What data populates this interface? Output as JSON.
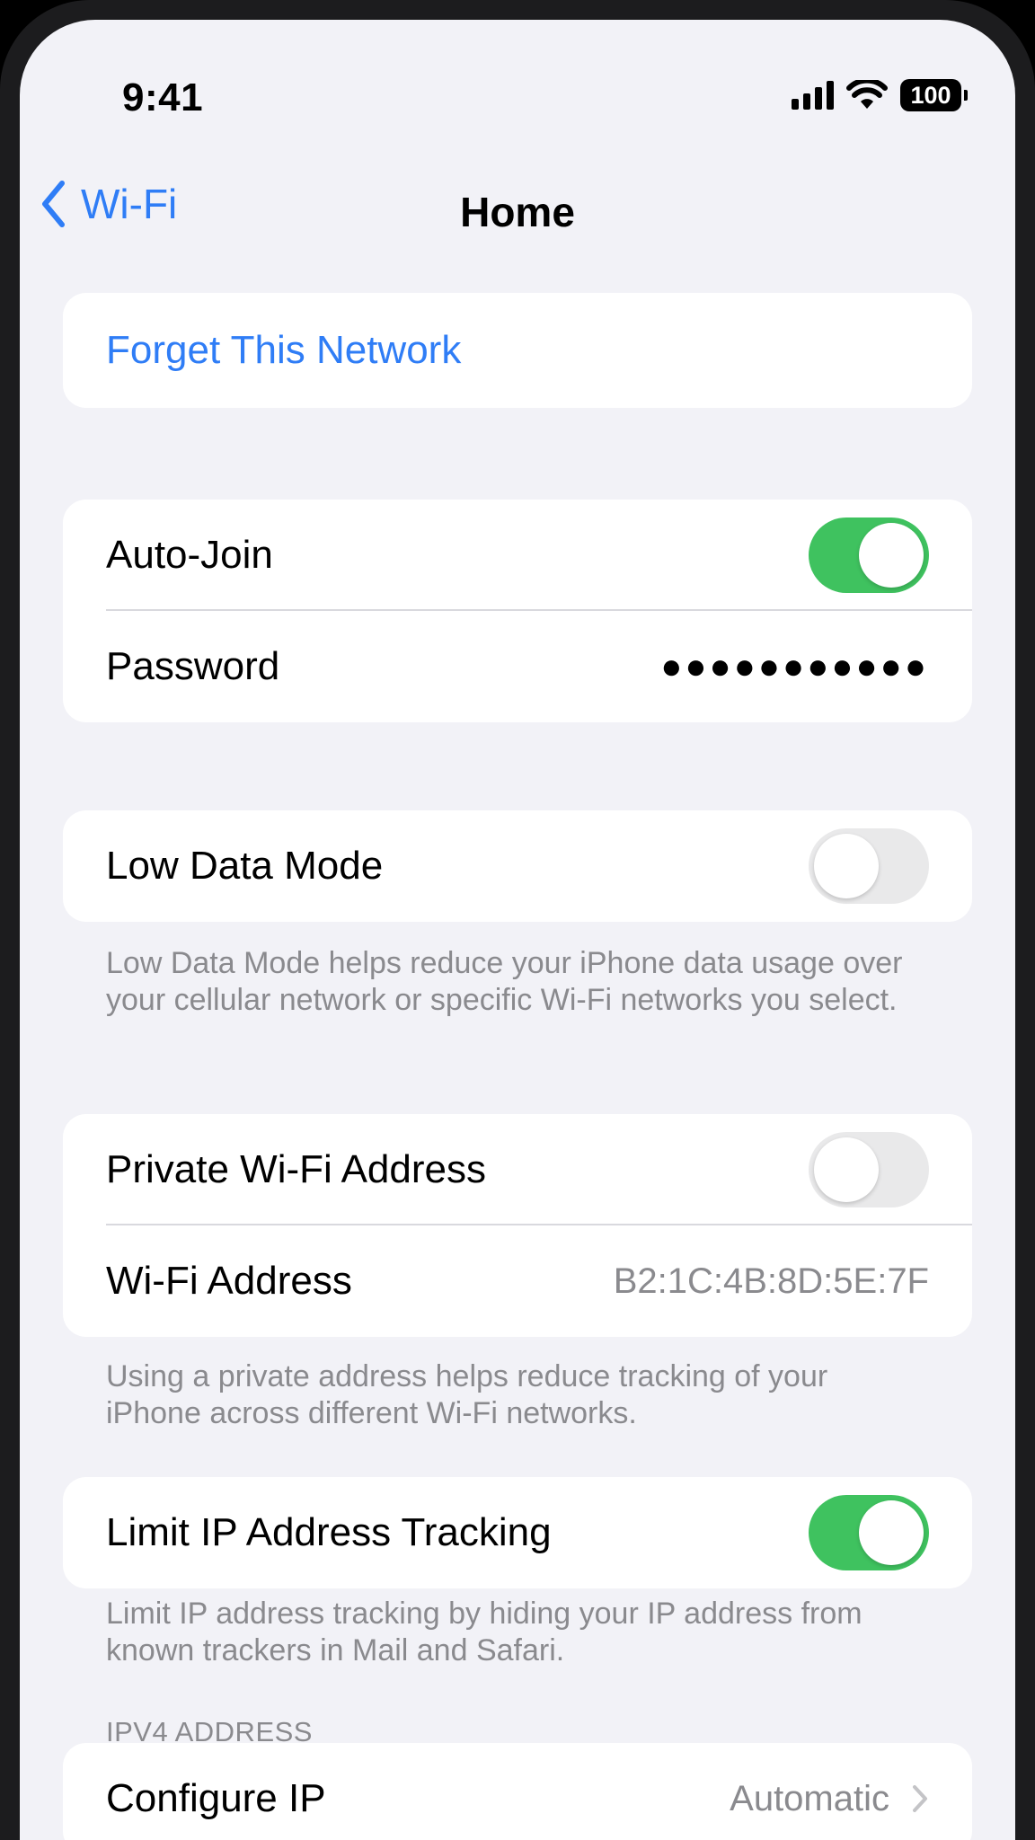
{
  "status_bar": {
    "time": "9:41",
    "battery": "100",
    "icons": [
      "signal-icon",
      "wifi-icon",
      "battery-icon"
    ]
  },
  "nav": {
    "back_label": "Wi-Fi",
    "title": "Home"
  },
  "actions": {
    "forget_network": "Forget This Network"
  },
  "auto_join": {
    "label": "Auto-Join",
    "enabled": true
  },
  "password": {
    "label": "Password",
    "value": "●●●●●●●●●●●"
  },
  "low_data_mode": {
    "label": "Low Data Mode",
    "enabled": false,
    "footnote": "Low Data Mode helps reduce your iPhone data usage over your cellular network or specific Wi-Fi networks you select."
  },
  "private_address": {
    "label": "Private Wi-Fi Address",
    "enabled": false,
    "wifi_address_label": "Wi-Fi Address",
    "wifi_address_value": "B2:1C:4B:8D:5E:7F",
    "footnote": "Using a private address helps reduce tracking of your iPhone across different Wi-Fi networks."
  },
  "limit_ip": {
    "label": "Limit IP Address Tracking",
    "enabled": true,
    "footnote": "Limit IP address tracking by hiding your IP address from known trackers in Mail and Safari."
  },
  "ipv4": {
    "header": "IPV4 ADDRESS",
    "configure_label": "Configure IP",
    "configure_value": "Automatic"
  },
  "colors": {
    "accent": "#2f7df6",
    "toggle_on": "#3fc25f",
    "toggle_off": "#e9e9ea",
    "background": "#f2f2f7"
  }
}
